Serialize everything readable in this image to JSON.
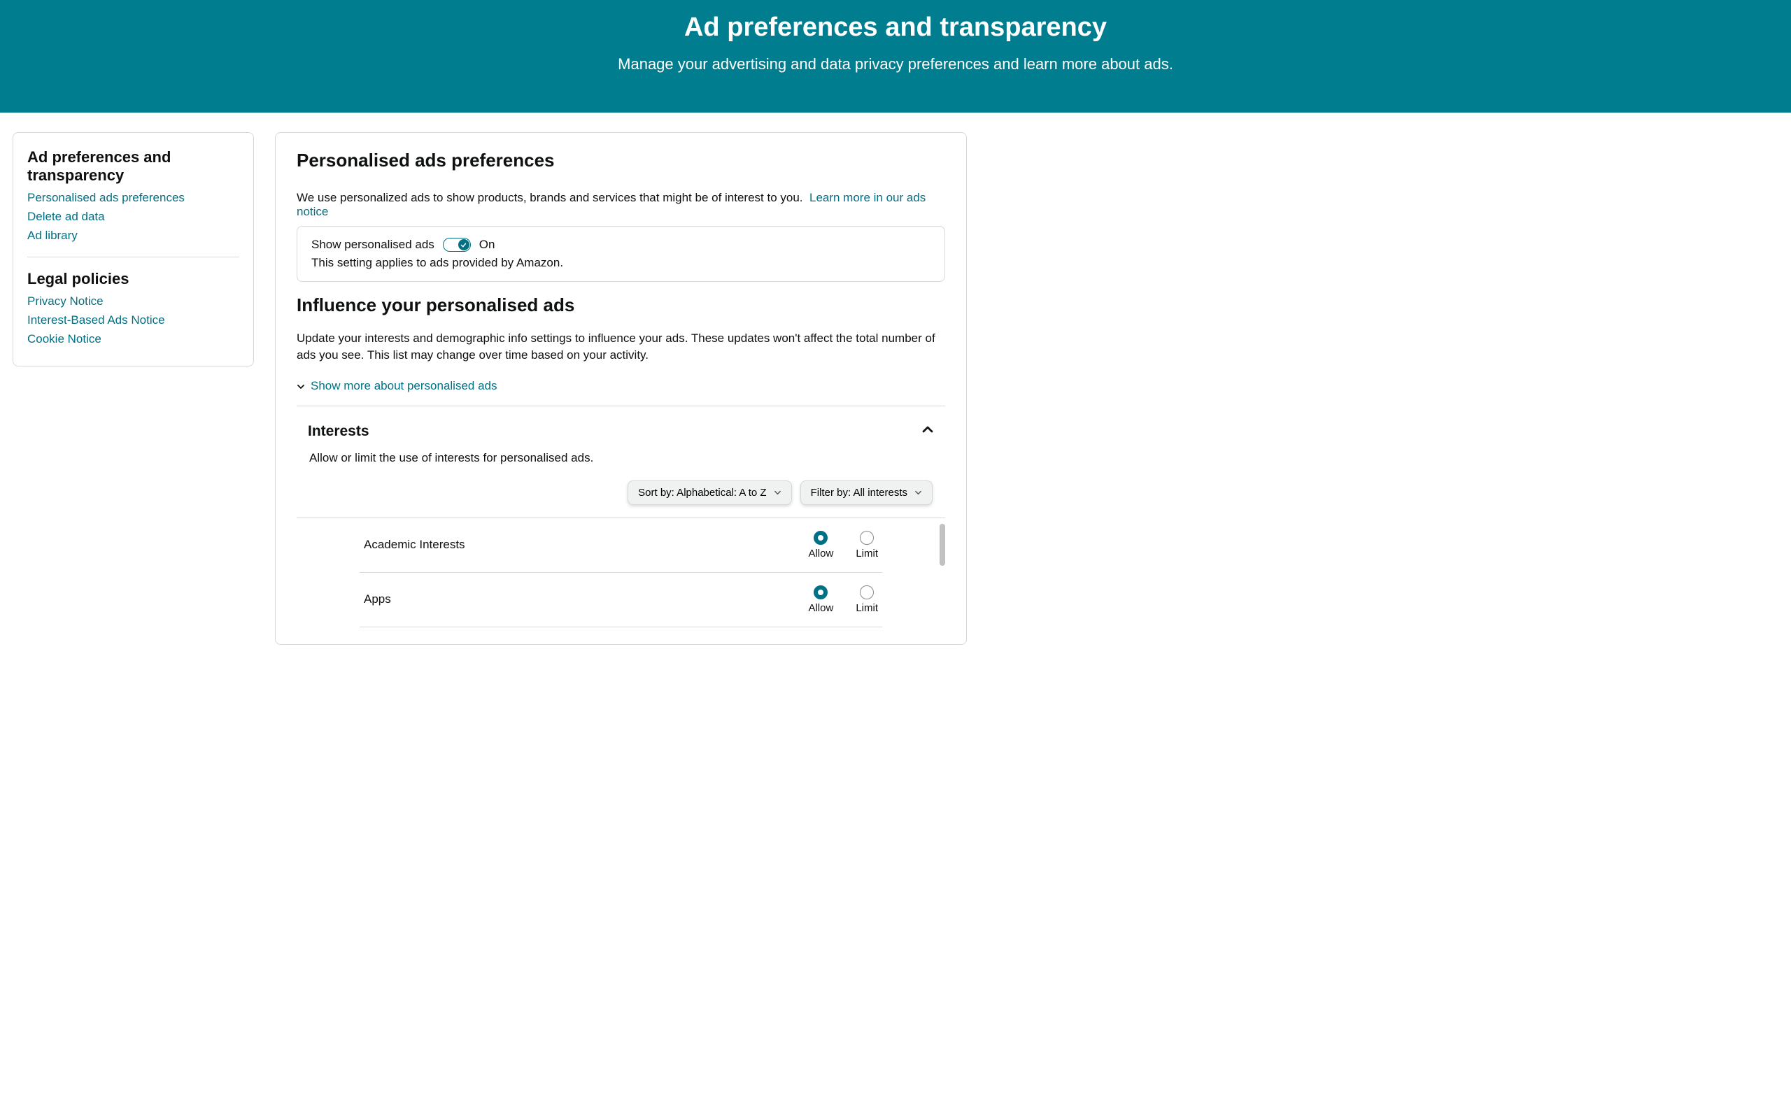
{
  "hero": {
    "title": "Ad preferences and transparency",
    "subtitle": "Manage your advertising and data privacy preferences and learn more about ads."
  },
  "sidebar": {
    "sections": [
      {
        "title": "Ad preferences and transparency",
        "links": [
          "Personalised ads preferences",
          "Delete ad data",
          "Ad library"
        ]
      },
      {
        "title": "Legal policies",
        "links": [
          "Privacy Notice",
          "Interest-Based Ads Notice",
          "Cookie Notice"
        ]
      }
    ]
  },
  "main": {
    "heading": "Personalised ads preferences",
    "intro_text": "We use personalized ads to show products, brands and services that might be of interest to you.",
    "intro_link": "Learn more in our ads notice",
    "toggle": {
      "label": "Show personalised ads",
      "state": "On",
      "note": "This setting applies to ads provided by Amazon."
    },
    "influence": {
      "heading": "Influence your personalised ads",
      "body": "Update your interests and demographic info settings to influence your ads. These updates won't affect the total number of ads you see. This list may change over time based on your activity.",
      "expander": "Show more about personalised ads"
    },
    "interests": {
      "title": "Interests",
      "sub": "Allow or limit the use of interests for personalised ads.",
      "sort_label": "Sort by: Alphabetical: A to Z",
      "filter_label": "Filter by: All interests",
      "allow_label": "Allow",
      "limit_label": "Limit",
      "items": [
        {
          "name": "Academic Interests",
          "selected": "allow"
        },
        {
          "name": "Apps",
          "selected": "allow"
        }
      ]
    }
  }
}
